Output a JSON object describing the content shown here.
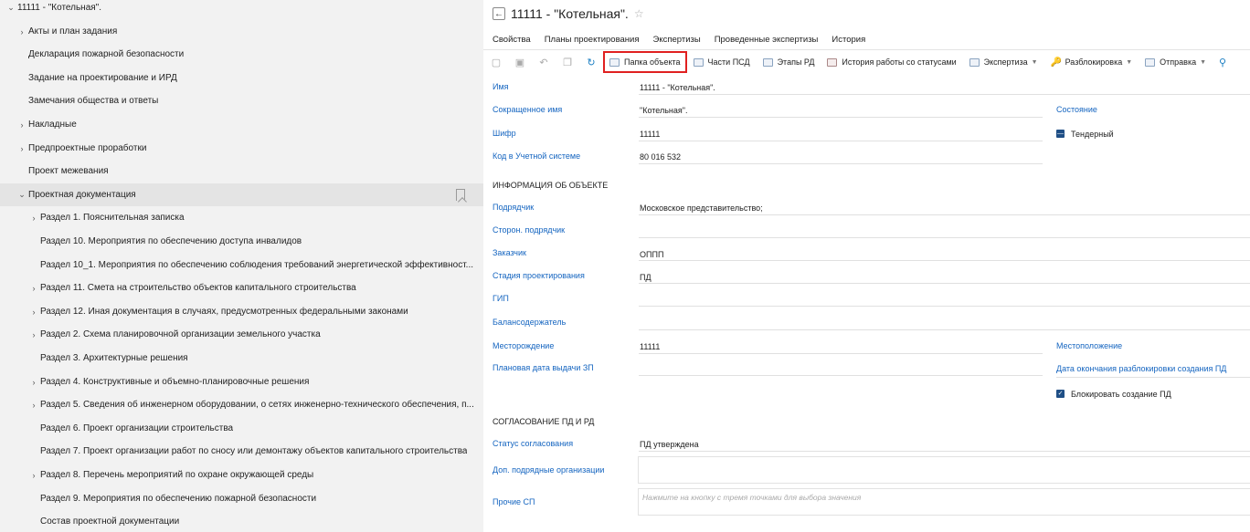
{
  "tree": {
    "items": [
      {
        "label": "11111 - \"Котельная\".",
        "level": 0,
        "chevron": "v"
      },
      {
        "label": "Акты и план задания",
        "level": 1,
        "chevron": ">"
      },
      {
        "label": "Декларация пожарной безопасности",
        "level": 1,
        "chevron": ""
      },
      {
        "label": "Задание на проектирование и ИРД",
        "level": 1,
        "chevron": ""
      },
      {
        "label": "Замечания общества и ответы",
        "level": 1,
        "chevron": ""
      },
      {
        "label": "Накладные",
        "level": 1,
        "chevron": ">"
      },
      {
        "label": "Предпроектные проработки",
        "level": 1,
        "chevron": ">"
      },
      {
        "label": "Проект межевания",
        "level": 1,
        "chevron": ""
      },
      {
        "label": "Проектная документация",
        "level": 1,
        "chevron": "v"
      },
      {
        "label": "Раздел 1. Пояснительная записка",
        "level": 2,
        "chevron": ">"
      },
      {
        "label": "Раздел 10. Мероприятия по обеспечению доступа инвалидов",
        "level": 2,
        "chevron": ""
      },
      {
        "label": "Раздел 10_1. Мероприятия по обеспечению соблюдения требований энергетической эффективност...",
        "level": 2,
        "chevron": ""
      },
      {
        "label": "Раздел 11. Смета на строительство объектов капитального строительства",
        "level": 2,
        "chevron": ">"
      },
      {
        "label": "Раздел 12. Иная документация в случаях, предусмотренных федеральными законами",
        "level": 2,
        "chevron": ">"
      },
      {
        "label": "Раздел 2. Схема планировочной организации земельного участка",
        "level": 2,
        "chevron": ">"
      },
      {
        "label": "Раздел 3. Архитектурные решения",
        "level": 2,
        "chevron": ""
      },
      {
        "label": "Раздел 4. Конструктивные и объемно-планировочные решения",
        "level": 2,
        "chevron": ">"
      },
      {
        "label": "Раздел 5. Сведения об инженерном оборудовании, о сетях инженерно-технического обеспечения, п...",
        "level": 2,
        "chevron": ">"
      },
      {
        "label": "Раздел 6. Проект организации строительства",
        "level": 2,
        "chevron": ""
      },
      {
        "label": "Раздел 7. Проект организации работ по сносу или демонтажу объектов капитального строительства",
        "level": 2,
        "chevron": ""
      },
      {
        "label": "Раздел 8. Перечень мероприятий по охране окружающей среды",
        "level": 2,
        "chevron": ">"
      },
      {
        "label": "Раздел 9. Мероприятия по обеспечению пожарной безопасности",
        "level": 2,
        "chevron": ""
      },
      {
        "label": "Состав проектной документации",
        "level": 2,
        "chevron": ""
      }
    ]
  },
  "header": {
    "back_icon": "arrow-left-icon",
    "title": "11111 - \"Котельная\".",
    "star_icon": "star-icon"
  },
  "tabs": [
    "Свойства",
    "Планы проектирования",
    "Экспертизы",
    "Проведенные экспертизы",
    "История"
  ],
  "toolbar": {
    "folder": "Папка объекта",
    "parts": "Части ПСД",
    "stages": "Этапы РД",
    "history": "История работы со статусами",
    "expertise": "Экспертиза",
    "unlock": "Разблокировка",
    "send": "Отправка"
  },
  "form": {
    "name_label": "Имя",
    "name_value": "11111 - \"Котельная\".",
    "short_label": "Сокращенное имя",
    "short_value": "\"Котельная\".",
    "cipher_label": "Шифр",
    "cipher_value": "11111",
    "code_label": "Код в Учетной системе",
    "code_value": "80 016 532",
    "state_label": "Состояние",
    "state_value": "Тендерный",
    "info_section": "ИНФОРМАЦИЯ ОБ ОБЪЕКТЕ",
    "contractor_label": "Подрядчик",
    "contractor_value": "Московское представительство;",
    "ext_contractor_label": "Сторон. подрядчик",
    "customer_label": "Заказчик",
    "customer_value": "ОППП",
    "stage_label": "Стадия проектирования",
    "stage_value": "ПД",
    "gip_label": "ГИП",
    "holder_label": "Балансодержатель",
    "field_label": "Месторождение",
    "field_value": "11111",
    "location_label": "Местоположение",
    "plan_date_label": "Плановая дата выдачи ЗП",
    "unlock_end_label": "Дата окончания разблокировки создания ПД",
    "block_pd_label": "Блокировать создание ПД",
    "approval_section": "СОГЛАСОВАНИЕ ПД И РД",
    "approval_status_label": "Статус согласования",
    "approval_status_value": "ПД утверждена",
    "extra_orgs_label": "Доп. подрядные организации",
    "other_sp_label": "Прочие СП",
    "other_sp_placeholder": "Нажмите на кнопку с тремя точками для выбора значения"
  }
}
